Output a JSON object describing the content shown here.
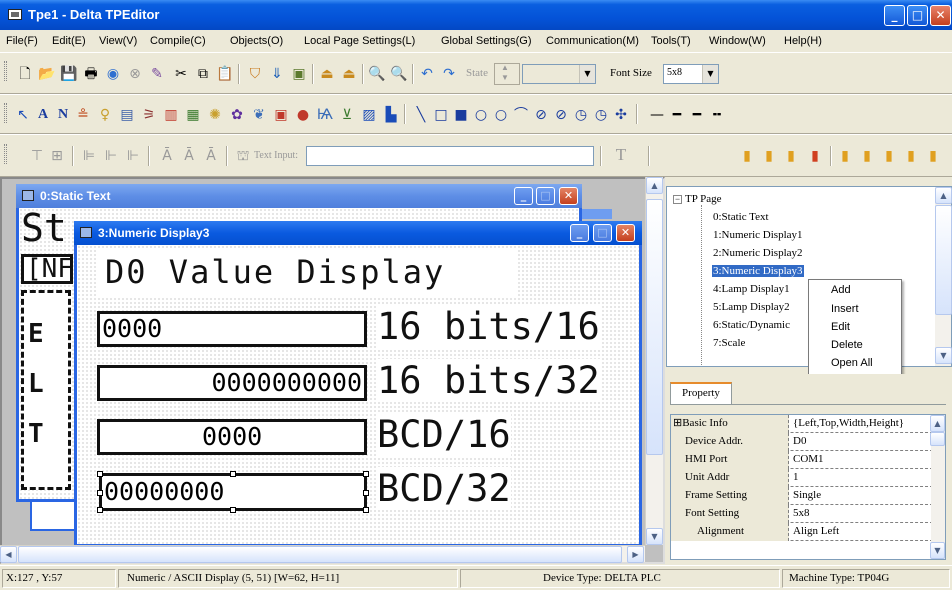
{
  "app": {
    "title": "Tpe1 - Delta TPEditor"
  },
  "menu": [
    "File(F)",
    "Edit(E)",
    "View(V)",
    "Compile(C)",
    "Objects(O)",
    "Local Page Settings(L)",
    "Global Settings(G)",
    "Communication(M)",
    "Tools(T)",
    "Window(W)",
    "Help(H)"
  ],
  "toolbar1": {
    "state_label": "State",
    "font_size_label": "Font Size",
    "font_size_value": "5x8"
  },
  "toolbar3": {
    "text_input_label": "Text Input:"
  },
  "windows": {
    "static_text": {
      "title": "0:Static Text",
      "preview_text": "St",
      "preview_row": "[NF",
      "side_letters": [
        "E",
        "L",
        "T"
      ]
    },
    "numeric_display": {
      "title": "3:Numeric Display3",
      "heading": "D0 Value Display",
      "rows": [
        {
          "value": "0000",
          "label": "16 bits/16"
        },
        {
          "value": "0000000000",
          "label": "16 bits/32"
        },
        {
          "value": "0000",
          "label": "BCD/16"
        },
        {
          "value": "00000000",
          "label": "BCD/32"
        }
      ]
    }
  },
  "tree": {
    "root": "TP Page",
    "items": [
      "0:Static Text",
      "1:Numeric Display1",
      "2:Numeric Display2",
      "3:Numeric Display3",
      "4:Lamp Display1",
      "5:Lamp Display2",
      "6:Static/Dynamic",
      "7:Scale"
    ],
    "selected_index": 3
  },
  "context_menu": [
    "Add",
    "Insert",
    "Edit",
    "Delete",
    "Open All"
  ],
  "property": {
    "tab": "Property",
    "rows": [
      {
        "key": "Basic Info",
        "value": "{Left,Top,Width,Height}"
      },
      {
        "key": "Device Addr.",
        "value": "D0"
      },
      {
        "key": "HMI Port",
        "value": "COM1"
      },
      {
        "key": "Unit Addr",
        "value": "1"
      },
      {
        "key": "Frame Setting",
        "value": "Single"
      },
      {
        "key": "Font Setting",
        "value": "5x8"
      },
      {
        "key": "Alignment",
        "value": "Align Left"
      }
    ]
  },
  "status": {
    "coords": "X:127 , Y:57",
    "object_info": "Numeric / ASCII Display (5, 51) [W=62, H=11]",
    "device_type": "Device Type: DELTA PLC",
    "machine_type": "Machine Type: TP04G"
  }
}
